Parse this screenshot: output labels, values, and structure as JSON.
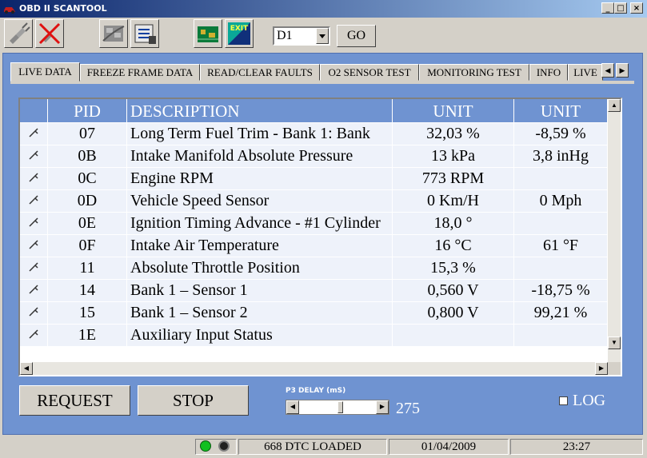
{
  "window": {
    "title": "OBD II SCANTOOL",
    "controls": {
      "minimize": "_",
      "maximize": "□",
      "close": "×"
    }
  },
  "toolbar": {
    "device_value": "D1",
    "go_label": "GO",
    "exit_icon_text": "EXIT",
    "icons": [
      "connect-icon",
      "disconnect-icon",
      "film-icon",
      "scanner-icon",
      "circuit-icon",
      "exit-icon"
    ]
  },
  "tabs": [
    {
      "label": "LIVE DATA",
      "active": true
    },
    {
      "label": "FREEZE FRAME DATA",
      "active": false
    },
    {
      "label": "READ/CLEAR FAULTS",
      "active": false
    },
    {
      "label": "O2 SENSOR TEST",
      "active": false
    },
    {
      "label": "MONITORING TEST",
      "active": false
    },
    {
      "label": "INFO",
      "active": false
    },
    {
      "label": "LIVE",
      "active": false
    }
  ],
  "grid": {
    "headers": {
      "pid": "PID",
      "description": "DESCRIPTION",
      "unit1": "UNIT",
      "unit2": "UNIT"
    },
    "rows": [
      {
        "pid": "07",
        "description": "Long Term Fuel Trim - Bank 1: Bank",
        "unit1": "32,03 %",
        "unit2": "-8,59 %"
      },
      {
        "pid": "0B",
        "description": "Intake Manifold Absolute Pressure",
        "unit1": "13 kPa",
        "unit2": "3,8 inHg"
      },
      {
        "pid": "0C",
        "description": "Engine RPM",
        "unit1": "773 RPM",
        "unit2": ""
      },
      {
        "pid": "0D",
        "description": "Vehicle Speed Sensor",
        "unit1": "0 Km/H",
        "unit2": "0 Mph"
      },
      {
        "pid": "0E",
        "description": "Ignition Timing Advance - #1 Cylinder",
        "unit1": "18,0 °",
        "unit2": ""
      },
      {
        "pid": "0F",
        "description": "Intake Air Temperature",
        "unit1": "16 °C",
        "unit2": "61 °F"
      },
      {
        "pid": "11",
        "description": "Absolute Throttle Position",
        "unit1": "15,3 %",
        "unit2": ""
      },
      {
        "pid": "14",
        "description": "Bank 1 – Sensor 1",
        "unit1": "0,560 V",
        "unit2": "-18,75 %"
      },
      {
        "pid": "15",
        "description": "Bank 1 – Sensor 2",
        "unit1": "0,800 V",
        "unit2": "99,21 %"
      },
      {
        "pid": "1E",
        "description": "Auxiliary Input Status",
        "unit1": "",
        "unit2": ""
      }
    ]
  },
  "controls": {
    "request_label": "REQUEST",
    "stop_label": "STOP",
    "p3_label": "P3 DELAY (mS)",
    "p3_value": "275",
    "log_label": "LOG"
  },
  "status": {
    "dtc": "668 DTC LOADED",
    "date": "01/04/2009",
    "time": "23:27",
    "led1_color": "#10c020",
    "led2_color": "#202020"
  }
}
